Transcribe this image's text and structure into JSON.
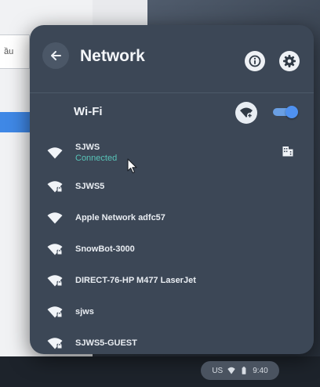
{
  "background": {
    "field_text": "ầu"
  },
  "panel": {
    "title": "Network",
    "wifi_label": "Wi-Fi",
    "wifi_enabled": true
  },
  "networks": [
    {
      "name": "SJWS",
      "status": "Connected",
      "icon": "wifi-full-icon",
      "enterprise": true
    },
    {
      "name": "SJWS5",
      "status": "",
      "icon": "wifi-secure-icon",
      "enterprise": false
    },
    {
      "name": "Apple Network adfc57",
      "status": "",
      "icon": "wifi-full-icon",
      "enterprise": false
    },
    {
      "name": "SnowBot-3000",
      "status": "",
      "icon": "wifi-secure-icon",
      "enterprise": false
    },
    {
      "name": "DIRECT-76-HP M477 LaserJet",
      "status": "",
      "icon": "wifi-secure-icon",
      "enterprise": false
    },
    {
      "name": "sjws",
      "status": "",
      "icon": "wifi-secure-icon",
      "enterprise": false
    },
    {
      "name": "SJWS5-GUEST",
      "status": "",
      "icon": "wifi-secure-icon",
      "enterprise": false
    }
  ],
  "tray": {
    "locale": "US",
    "time": "9:40"
  },
  "colors": {
    "panel_bg": "#3c4756",
    "accent_blue": "#4f91f0",
    "connected_teal": "#58c4b8"
  }
}
